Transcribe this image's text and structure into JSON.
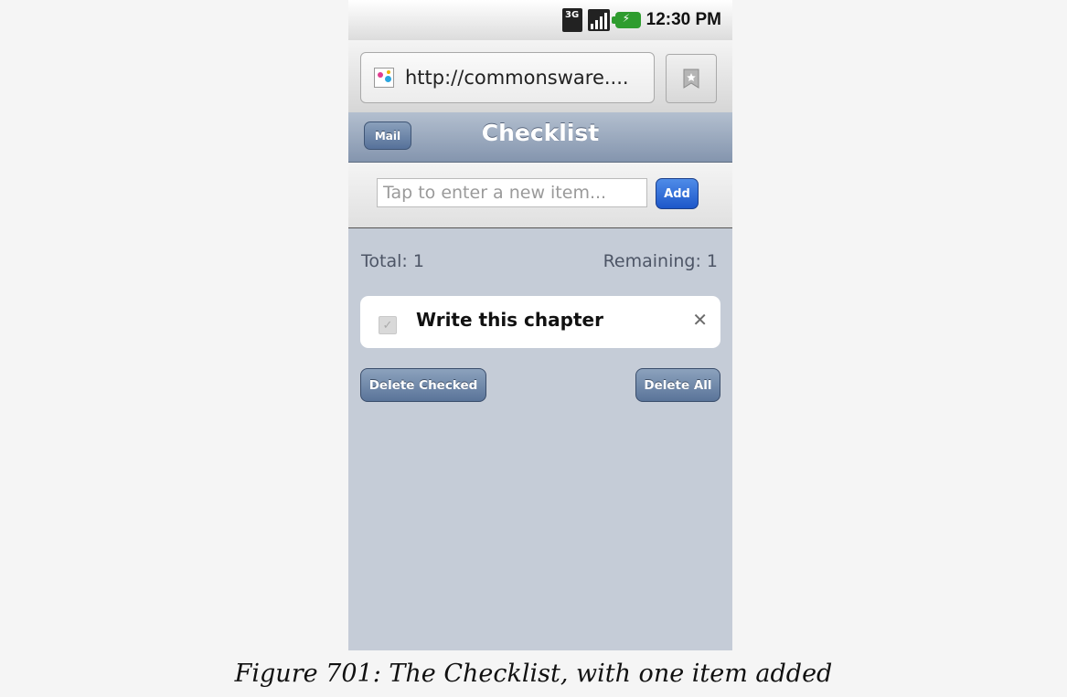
{
  "status_bar": {
    "network_label": "3G",
    "time": "12:30 PM",
    "icons": [
      "3g-network-icon",
      "signal-strength-icon",
      "battery-charging-icon"
    ]
  },
  "browser": {
    "url": "http://commonsware....",
    "icons": [
      "favicon-icon",
      "bookmark-icon"
    ]
  },
  "app": {
    "header": {
      "title": "Checklist",
      "mail_button": "Mail"
    },
    "new_item": {
      "placeholder": "Tap to enter a new item...",
      "value": "",
      "add_button": "Add"
    },
    "counters": {
      "total": "Total: 1",
      "remaining": "Remaining: 1"
    },
    "items": [
      {
        "label": "Write this chapter",
        "checked": false,
        "remove_glyph": "✕"
      }
    ],
    "actions": {
      "delete_checked": "Delete Checked",
      "delete_all": "Delete All"
    }
  },
  "caption": "Figure 701: The Checklist, with one item added",
  "colors": {
    "header_blue": "#8495ae",
    "content_bg": "#c5ccd7",
    "add_button_blue": "#1d57c9",
    "battery_green": "#2f9c2f"
  }
}
